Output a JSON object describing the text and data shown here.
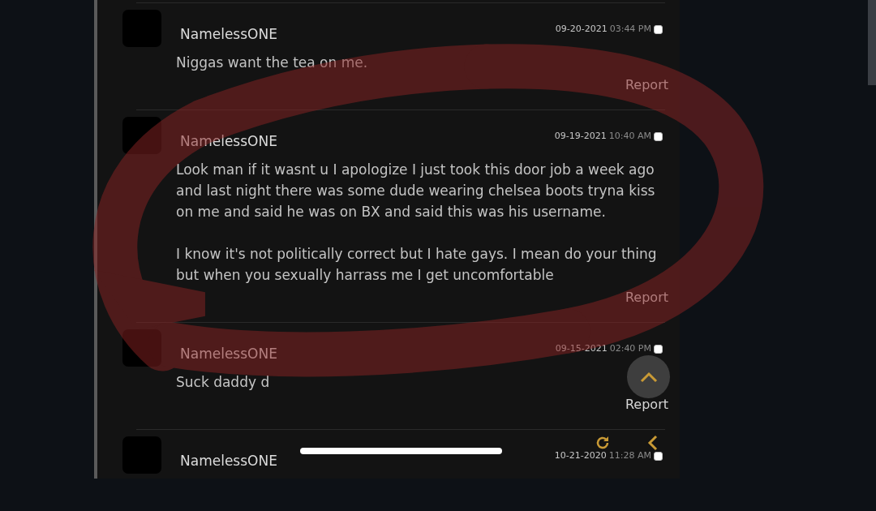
{
  "comments": [
    {
      "author": "NamelessONE",
      "date": "09-20-2021",
      "time": "03:44 PM",
      "checked": false,
      "paragraphs": [
        "Niggas want the tea on me."
      ],
      "report": "Report"
    },
    {
      "author": "NamelessONE",
      "date": "09-19-2021",
      "time": "10:40 AM",
      "checked": false,
      "paragraphs": [
        "Look man if it wasnt u I apologize I just took this door job a week ago and last night there was some dude wearing chelsea boots tryna kiss on me and said he was on BX and said this was his username.",
        "I know it's not politically correct but I hate gays. I mean do your thing but when you sexually harrass me I get uncomfortable"
      ],
      "report": "Report"
    },
    {
      "author": "NamelessONE",
      "date": "09-15-2021",
      "time": "02:40 PM",
      "checked": false,
      "paragraphs": [
        "Suck daddy d"
      ],
      "report": "Report"
    },
    {
      "author": "NamelessONE",
      "date": "10-21-2020",
      "time": "11:28 AM",
      "checked": false
    }
  ]
}
